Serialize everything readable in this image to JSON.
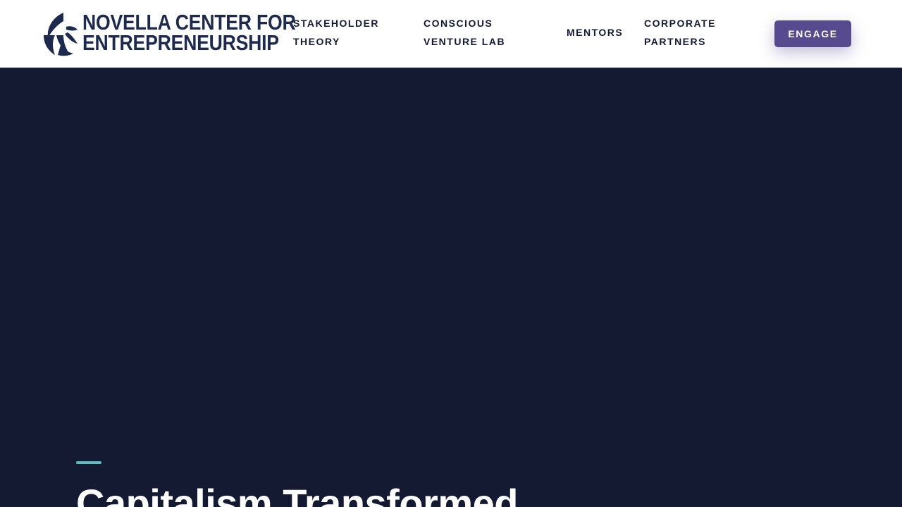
{
  "header": {
    "logo": {
      "line1": "NOVELLA CENTER FOR",
      "line2": "ENTREPRENEURSHIP",
      "icon": "swirl-logo-icon"
    },
    "nav": {
      "stakeholder_theory": "STAKEHOLDER THEORY",
      "conscious_venture_lab": "CONSCIOUS VENTURE LAB",
      "mentors": "MENTORS",
      "corporate_partners": "CORPORATE PARTNERS"
    },
    "engage_label": "ENGAGE"
  },
  "hero": {
    "title": "Capitalism Transformed"
  },
  "colors": {
    "header_bg": "#ffffff",
    "logo_navy": "#1d2a4d",
    "hero_bg": "#151a33",
    "button_purple": "#574a8f",
    "accent_teal": "#5fbcc1"
  }
}
